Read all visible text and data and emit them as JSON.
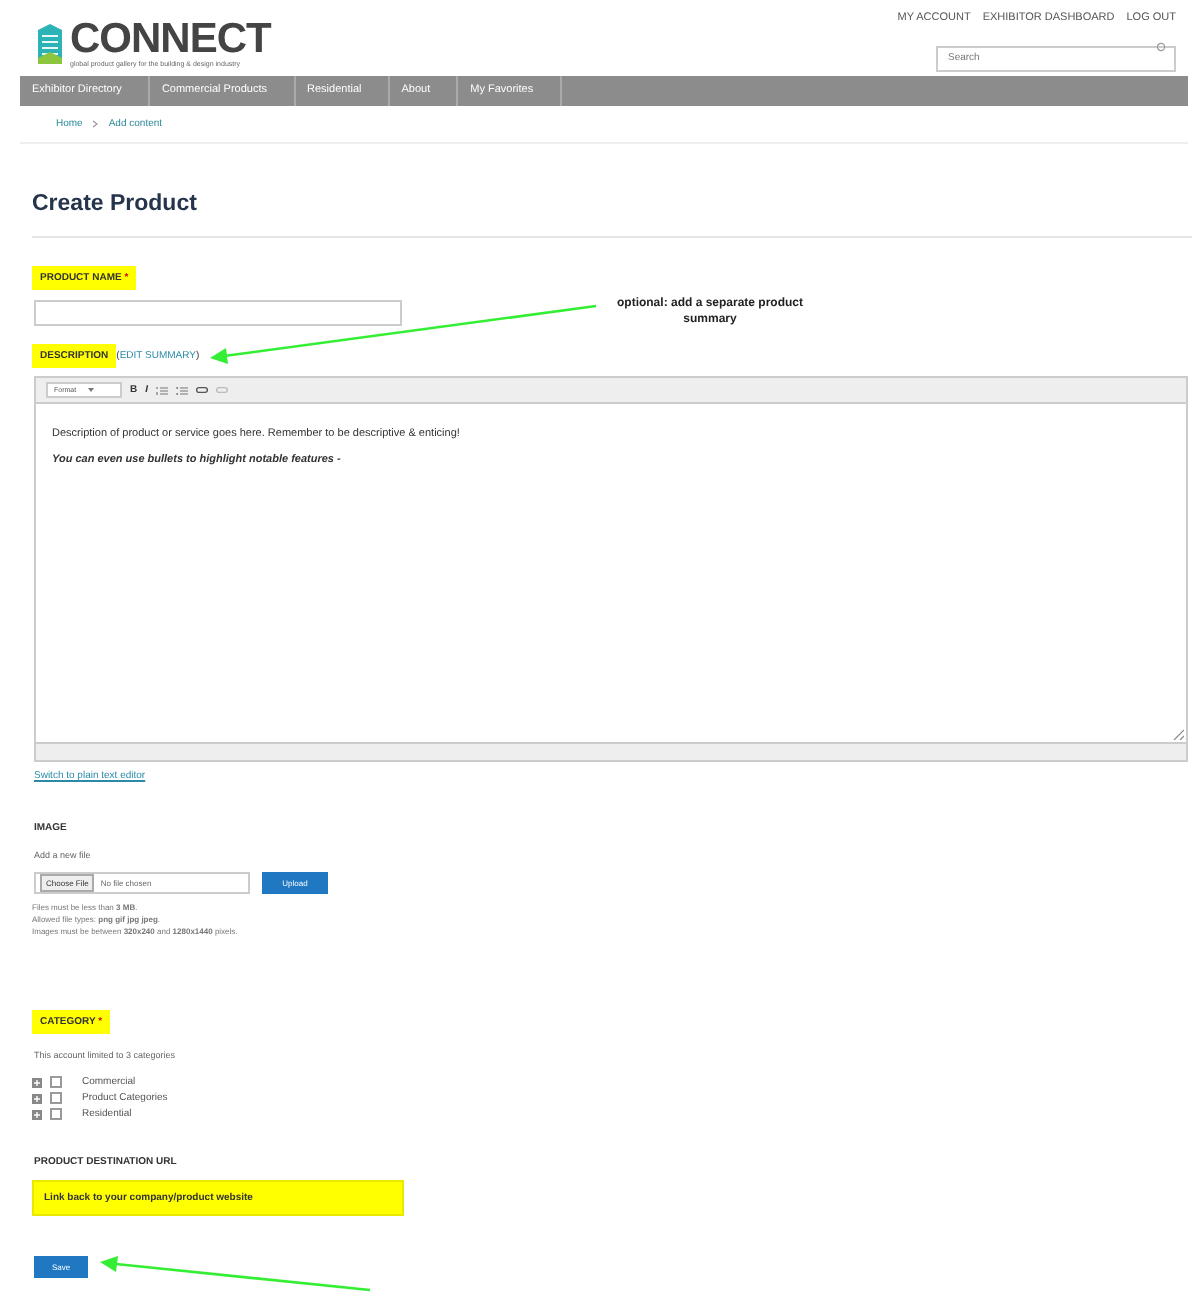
{
  "header": {
    "logo": "CONNECT",
    "tagline": "global product gallery for the building & design industry",
    "links": [
      "MY ACCOUNT",
      "EXHIBITOR DASHBOARD",
      "LOG OUT"
    ],
    "search": {
      "placeholder": "Search"
    }
  },
  "nav": [
    "Exhibitor Directory",
    "Commercial Products",
    "Residential",
    "About",
    "My Favorites"
  ],
  "breadcrumb": [
    "Home",
    "Add content"
  ],
  "title": "Create Product",
  "product_name": {
    "label": "PRODUCT NAME",
    "required": "*"
  },
  "description": {
    "label": "DESCRIPTION",
    "link_open": "(",
    "link": "EDIT SUMMARY",
    "link_close": ")",
    "toolbar": {
      "format": "Format",
      "bold": "B",
      "italic": "I"
    },
    "text": "Description of product or service goes here. Remember to be descriptive & enticing!",
    "bullets": "You can even use bullets to highlight notable features -",
    "switch_link": "Switch to plain text editor"
  },
  "annotations": [
    {
      "text": "optional: add a separate product summary"
    }
  ],
  "image": {
    "label": "IMAGE",
    "sublabel": "Add a new file",
    "choose": "Choose File",
    "no_file": "No file chosen",
    "upload": "Upload",
    "help": [
      "Files must be less than **3 MB**.",
      "Allowed file types: **png gif jpg jpeg**.",
      "Images must be between **320x240** and **1280x1440** pixels."
    ]
  },
  "category": {
    "label": "CATEGORY",
    "required": "*",
    "note": "This account limited to 3 categories",
    "items": [
      {
        "label": "Commercial",
        "checked": false
      },
      {
        "label": "Product Categories",
        "checked": false
      },
      {
        "label": "Residential",
        "checked": false
      }
    ]
  },
  "destination": {
    "label": "PRODUCT DESTINATION URL",
    "value": "Link back to your company/product website"
  },
  "save": "Save"
}
